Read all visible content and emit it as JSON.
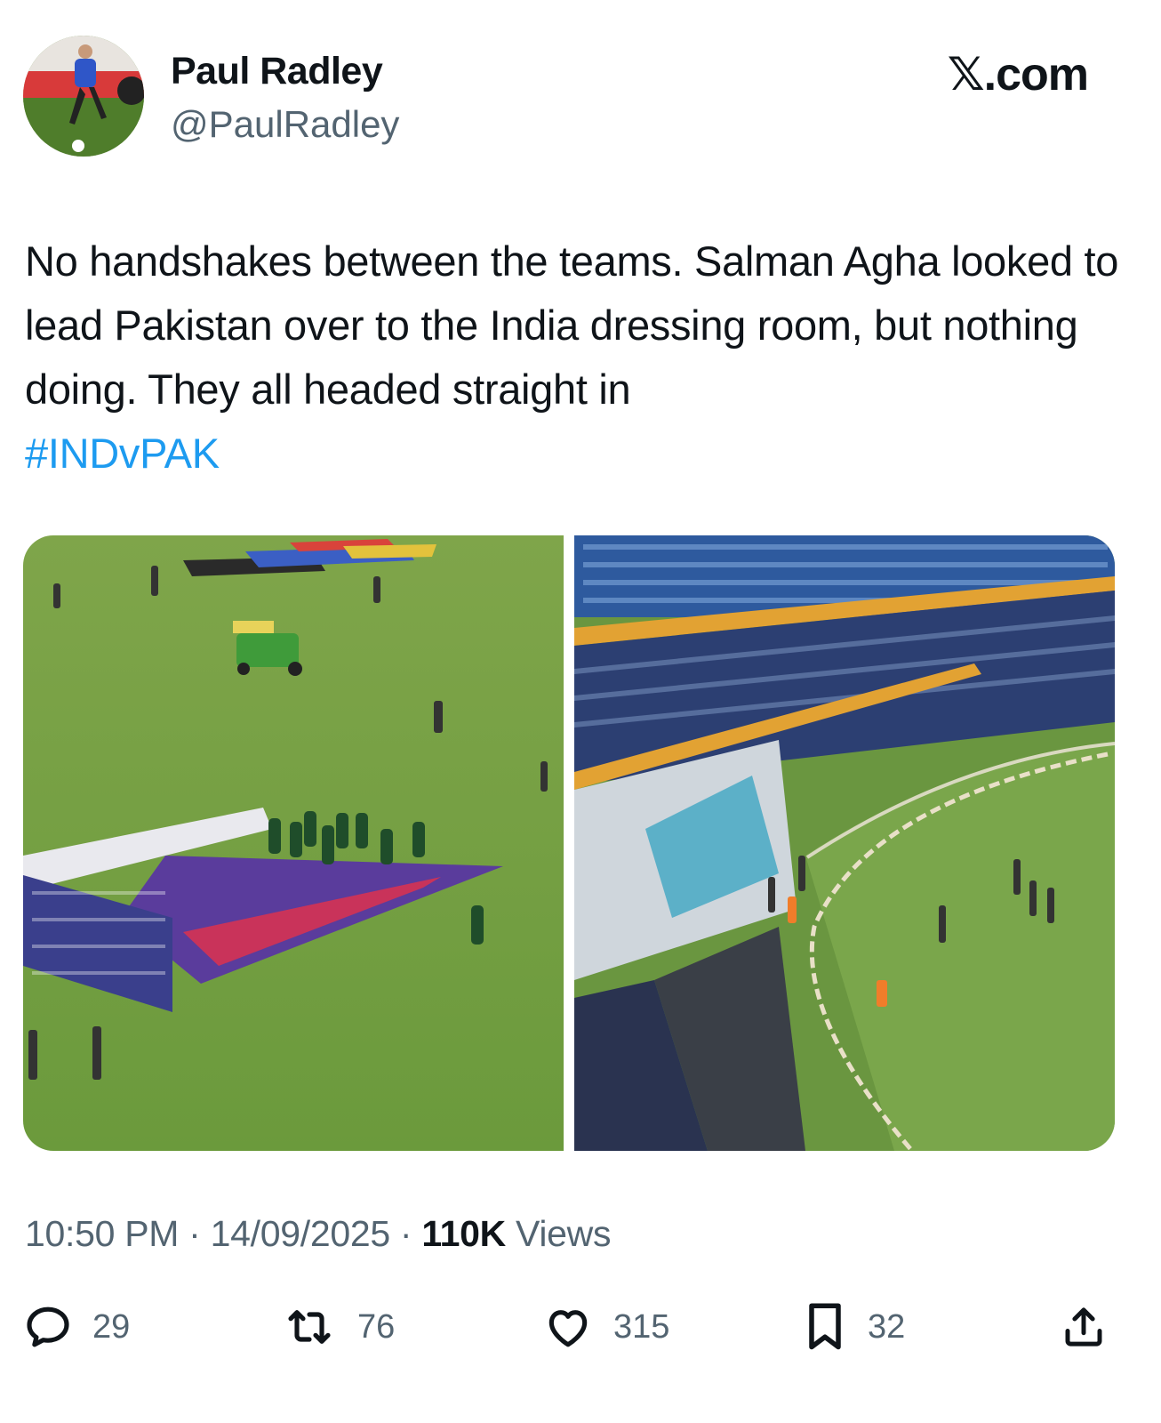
{
  "author": {
    "name": "Paul Radley",
    "handle": "@PaulRadley",
    "avatar_icon": "user-avatar-photo"
  },
  "brand": {
    "x_glyph": "𝕏",
    "suffix": ".com"
  },
  "tweet": {
    "text": "No handshakes between the teams. Salman Agha looked to lead Pakistan over to the India dressing room, but nothing doing. They all headed straight in",
    "hashtag": "#INDvPAK"
  },
  "media": {
    "photos": [
      {
        "icon": "cricket-ground-players-photo"
      },
      {
        "icon": "stadium-stands-boundary-photo"
      }
    ]
  },
  "meta": {
    "time": "10:50 PM",
    "separator": " · ",
    "date": "14/09/2025",
    "views_count": "110K",
    "views_label": " Views"
  },
  "actions": {
    "replies": {
      "count": "29",
      "icon": "reply-icon"
    },
    "reposts": {
      "count": "76",
      "icon": "repost-icon"
    },
    "likes": {
      "count": "315",
      "icon": "like-heart-icon"
    },
    "bookmarks": {
      "count": "32",
      "icon": "bookmark-icon"
    },
    "share": {
      "icon": "share-icon"
    }
  },
  "colors": {
    "hashtag": "#1d9bf0",
    "secondary_text": "#536471",
    "primary_text": "#0f1419"
  }
}
